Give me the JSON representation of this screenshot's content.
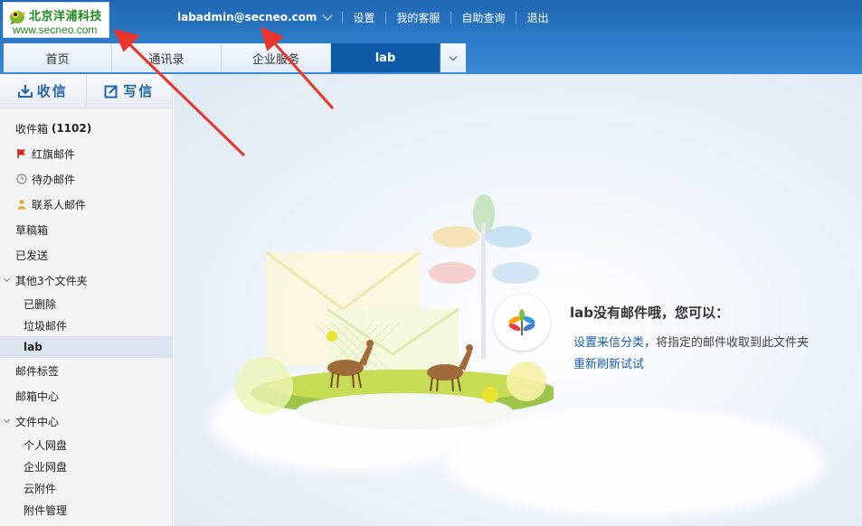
{
  "logo": {
    "title": "北京洋浦科技",
    "url": "www.secneo.com"
  },
  "topnav": {
    "user": "labadmin@secneo.com",
    "links": [
      "设置",
      "我的客服",
      "自助查询",
      "退出"
    ]
  },
  "tabs": [
    "首页",
    "通讯录",
    "企业服务",
    "lab"
  ],
  "actions": {
    "receive": "收信",
    "compose": "写信"
  },
  "folders": {
    "inbox_label": "收件箱",
    "inbox_count": "(1102)",
    "flagged": "红旗邮件",
    "todo": "待办邮件",
    "contacts": "联系人邮件",
    "drafts": "草稿箱",
    "sent": "已发送",
    "other": "其他3个文件夹",
    "deleted": "已删除",
    "spam": "垃圾邮件",
    "lab": "lab",
    "tags": "邮件标签",
    "mailbox_center": "邮箱中心",
    "file_center": "文件中心",
    "personal_disk": "个人网盘",
    "company_disk": "企业网盘",
    "cloud_attach": "云附件",
    "attach_manage": "附件管理"
  },
  "empty": {
    "title": "lab没有邮件哦，您可以：",
    "link1": "设置来信分类",
    "line1_rest": "，将指定的邮件收取到此文件夹",
    "link2": "重新刷新试试"
  },
  "colors": {
    "header": "#2d7bc8",
    "active_tab": "#0f5aa7",
    "link": "#1b5fb0",
    "annotation": "#e8342a"
  }
}
